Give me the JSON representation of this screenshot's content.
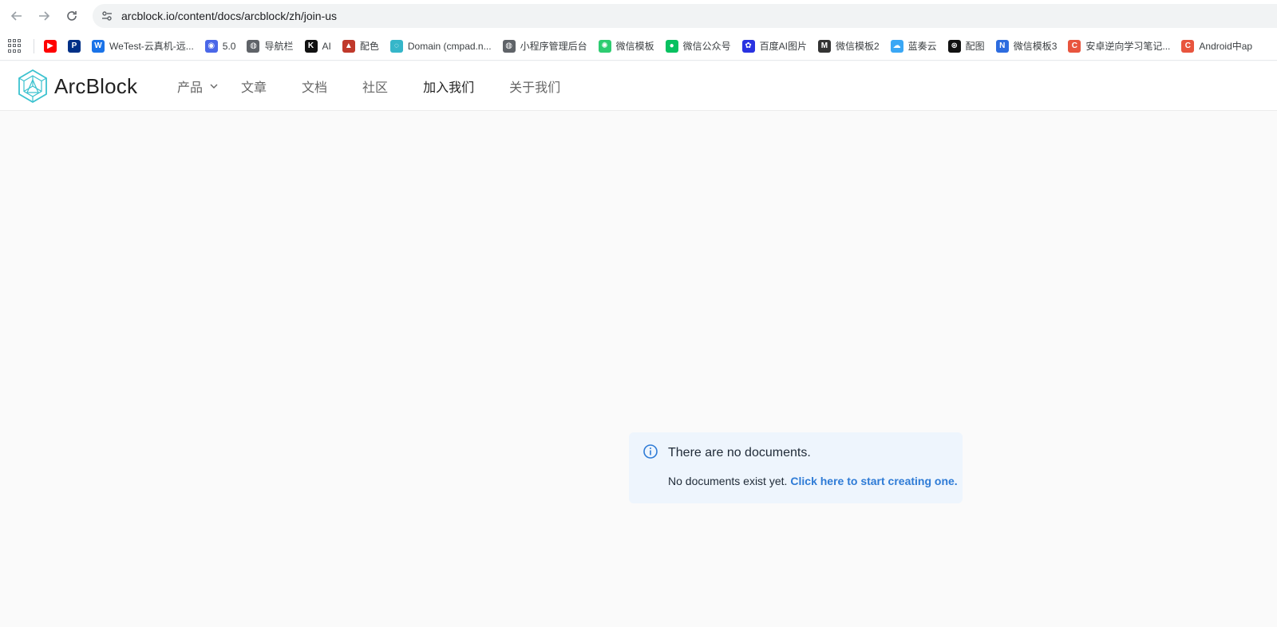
{
  "browser": {
    "url": "arcblock.io/content/docs/arcblock/zh/join-us"
  },
  "bookmarks": [
    {
      "label": "",
      "icon": "youtube-icon",
      "color": "#ff0000"
    },
    {
      "label": "",
      "icon": "paypal-icon",
      "color": "#003087"
    },
    {
      "label": "WeTest-云真机-远...",
      "icon": "wetest-icon",
      "color": "#1a73e8"
    },
    {
      "label": "5.0",
      "icon": "robot-icon",
      "color": "#4a67e8"
    },
    {
      "label": "导航栏",
      "icon": "globe-icon",
      "color": "#5f6368"
    },
    {
      "label": "AI",
      "icon": "k-icon",
      "color": "#111111"
    },
    {
      "label": "配色",
      "icon": "palette-icon",
      "color": "#c0392b"
    },
    {
      "label": "Domain (cmpad.n...",
      "icon": "domain-icon",
      "color": "#35b6c9"
    },
    {
      "label": "小程序管理后台",
      "icon": "globe-icon",
      "color": "#5f6368"
    },
    {
      "label": "微信模板",
      "icon": "sparkle-icon",
      "color": "#2ecc71"
    },
    {
      "label": "微信公众号",
      "icon": "wechat-icon",
      "color": "#07c160"
    },
    {
      "label": "百度AI图片",
      "icon": "baidu-paw-icon",
      "color": "#2932e1"
    },
    {
      "label": "微信模板2",
      "icon": "m-circle-icon",
      "color": "#333333"
    },
    {
      "label": "蓝奏云",
      "icon": "cloud-icon",
      "color": "#3aa7f5"
    },
    {
      "label": "配图",
      "icon": "openai-icon",
      "color": "#111111"
    },
    {
      "label": "微信模板3",
      "icon": "n-icon",
      "color": "#2d6cdf"
    },
    {
      "label": "安卓逆向学习笔记...",
      "icon": "c-icon",
      "color": "#e8553e"
    },
    {
      "label": "Android中ap",
      "icon": "c-icon",
      "color": "#e8553e"
    }
  ],
  "site": {
    "logo_text": "ArcBlock",
    "brand_color": "#3bc2cf",
    "menu": [
      {
        "label": "产品",
        "dropdown": true,
        "active": false
      },
      {
        "label": "文章",
        "dropdown": false,
        "active": false
      },
      {
        "label": "文档",
        "dropdown": false,
        "active": false
      },
      {
        "label": "社区",
        "dropdown": false,
        "active": false
      },
      {
        "label": "加入我们",
        "dropdown": false,
        "active": true
      },
      {
        "label": "关于我们",
        "dropdown": false,
        "active": false
      }
    ]
  },
  "notice": {
    "title": "There are no documents.",
    "body": "No documents exist yet.",
    "link": "Click here to start creating one.",
    "accent_color": "#2e7bd6",
    "bg_color": "#eef5fd"
  }
}
